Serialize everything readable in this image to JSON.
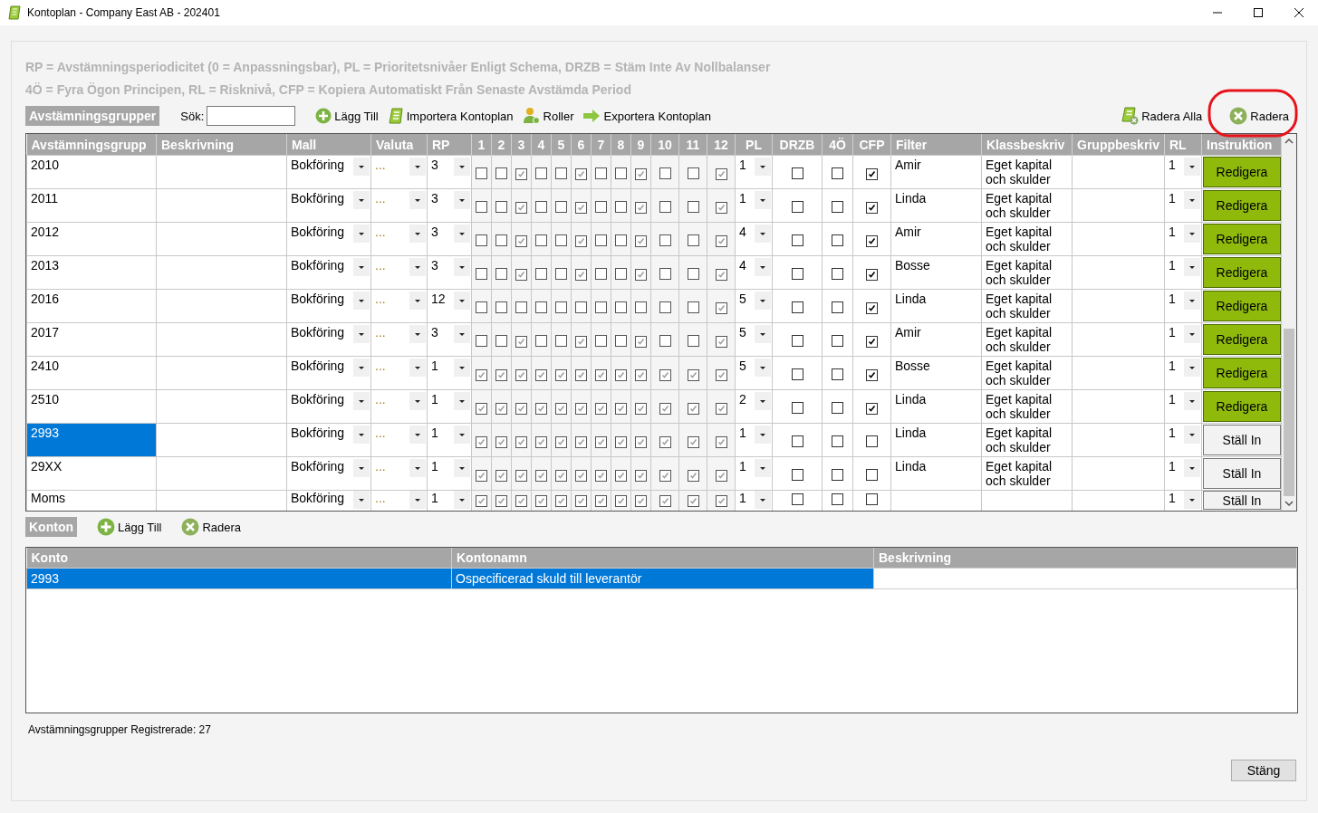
{
  "window": {
    "title": "Kontoplan - Company East AB - 202401"
  },
  "legend": [
    "RP = Avstämningsperiodicitet (0 = Anpassningsbar), PL = Prioritetsnivåer Enligt Schema, DRZB = Stäm Inte Av Nollbalanser",
    "4Ö = Fyra Ögon Principen, RL = Risknivå, CFP = Kopiera Automatiskt Från Senaste Avstämda Period"
  ],
  "toolbar": {
    "section_label": "Avstämningsgrupper",
    "search_label": "Sök:",
    "left_actions": [
      {
        "label": "Lägg Till",
        "kind": "add"
      },
      {
        "label": "Importera Kontoplan",
        "kind": "import"
      },
      {
        "label": "Roller",
        "kind": "roles"
      },
      {
        "label": "Exportera Kontoplan",
        "kind": "export"
      }
    ],
    "right_actions": [
      {
        "label": "Radera Alla",
        "kind": "delete_all",
        "highlighted": false
      },
      {
        "label": "Radera",
        "kind": "delete",
        "highlighted": true
      }
    ]
  },
  "groups_table": {
    "columns": [
      "Avstämningsgrupp",
      "Beskrivning",
      "Mall",
      "Valuta",
      "RP",
      "1",
      "2",
      "3",
      "4",
      "5",
      "6",
      "7",
      "8",
      "9",
      "10",
      "11",
      "12",
      "PL",
      "DRZB",
      "4Ö",
      "CFP",
      "Filter",
      "Klassbeskriv",
      "Gruppbeskriv",
      "RL",
      "Instruktion"
    ],
    "rows": [
      {
        "group": "2010",
        "template": "Bokföring",
        "currency": "...",
        "rp": "3",
        "months": [
          false,
          false,
          true,
          false,
          false,
          true,
          false,
          false,
          true,
          false,
          false,
          true
        ],
        "pl": "1",
        "drzb": false,
        "four_eyes": false,
        "cfp": true,
        "filter": "Amir",
        "class_desc": "Eget kapital och skulder",
        "rl": "1",
        "instruction": {
          "label": "Redigera",
          "kind": "edit"
        },
        "selected": false
      },
      {
        "group": "2011",
        "template": "Bokföring",
        "currency": "...",
        "rp": "3",
        "months": [
          false,
          false,
          true,
          false,
          false,
          true,
          false,
          false,
          true,
          false,
          false,
          true
        ],
        "pl": "1",
        "drzb": false,
        "four_eyes": false,
        "cfp": true,
        "filter": "Linda",
        "class_desc": "Eget kapital och skulder",
        "rl": "1",
        "instruction": {
          "label": "Redigera",
          "kind": "edit"
        },
        "selected": false
      },
      {
        "group": "2012",
        "template": "Bokföring",
        "currency": "...",
        "rp": "3",
        "months": [
          false,
          false,
          true,
          false,
          false,
          true,
          false,
          false,
          true,
          false,
          false,
          true
        ],
        "pl": "4",
        "drzb": false,
        "four_eyes": false,
        "cfp": true,
        "filter": "Amir",
        "class_desc": "Eget kapital och skulder",
        "rl": "1",
        "instruction": {
          "label": "Redigera",
          "kind": "edit"
        },
        "selected": false
      },
      {
        "group": "2013",
        "template": "Bokföring",
        "currency": "...",
        "rp": "3",
        "months": [
          false,
          false,
          true,
          false,
          false,
          true,
          false,
          false,
          true,
          false,
          false,
          true
        ],
        "pl": "4",
        "drzb": false,
        "four_eyes": false,
        "cfp": true,
        "filter": "Bosse",
        "class_desc": "Eget kapital och skulder",
        "rl": "1",
        "instruction": {
          "label": "Redigera",
          "kind": "edit"
        },
        "selected": false
      },
      {
        "group": "2016",
        "template": "Bokföring",
        "currency": "...",
        "rp": "12",
        "months": [
          false,
          false,
          false,
          false,
          false,
          false,
          false,
          false,
          false,
          false,
          false,
          true
        ],
        "pl": "5",
        "drzb": false,
        "four_eyes": false,
        "cfp": true,
        "filter": "Linda",
        "class_desc": "Eget kapital och skulder",
        "rl": "1",
        "instruction": {
          "label": "Redigera",
          "kind": "edit"
        },
        "selected": false
      },
      {
        "group": "2017",
        "template": "Bokföring",
        "currency": "...",
        "rp": "3",
        "months": [
          false,
          false,
          true,
          false,
          false,
          true,
          false,
          false,
          true,
          false,
          false,
          true
        ],
        "pl": "5",
        "drzb": false,
        "four_eyes": false,
        "cfp": true,
        "filter": "Amir",
        "class_desc": "Eget kapital och skulder",
        "rl": "1",
        "instruction": {
          "label": "Redigera",
          "kind": "edit"
        },
        "selected": false
      },
      {
        "group": "2410",
        "template": "Bokföring",
        "currency": "...",
        "rp": "1",
        "months": [
          true,
          true,
          true,
          true,
          true,
          true,
          true,
          true,
          true,
          true,
          true,
          true
        ],
        "pl": "5",
        "drzb": false,
        "four_eyes": false,
        "cfp": true,
        "filter": "Bosse",
        "class_desc": "Eget kapital och skulder",
        "rl": "1",
        "instruction": {
          "label": "Redigera",
          "kind": "edit"
        },
        "selected": false
      },
      {
        "group": "2510",
        "template": "Bokföring",
        "currency": "...",
        "rp": "1",
        "months": [
          true,
          true,
          true,
          true,
          true,
          true,
          true,
          true,
          true,
          true,
          true,
          true
        ],
        "pl": "2",
        "drzb": false,
        "four_eyes": false,
        "cfp": true,
        "filter": "Linda",
        "class_desc": "Eget kapital och skulder",
        "rl": "1",
        "instruction": {
          "label": "Redigera",
          "kind": "edit"
        },
        "selected": false
      },
      {
        "group": "2993",
        "template": "Bokföring",
        "currency": "...",
        "rp": "1",
        "months": [
          true,
          true,
          true,
          true,
          true,
          true,
          true,
          true,
          true,
          true,
          true,
          true
        ],
        "pl": "1",
        "drzb": false,
        "four_eyes": false,
        "cfp": false,
        "filter": "Linda",
        "class_desc": "Eget kapital och skulder",
        "rl": "1",
        "instruction": {
          "label": "Ställ In",
          "kind": "set"
        },
        "selected": true
      },
      {
        "group": "29XX",
        "template": "Bokföring",
        "currency": "...",
        "rp": "1",
        "months": [
          true,
          true,
          true,
          true,
          true,
          true,
          true,
          true,
          true,
          true,
          true,
          true
        ],
        "pl": "1",
        "drzb": false,
        "four_eyes": false,
        "cfp": false,
        "filter": "Linda",
        "class_desc": "Eget kapital och skulder",
        "rl": "1",
        "instruction": {
          "label": "Ställ In",
          "kind": "set"
        },
        "selected": false
      },
      {
        "group": "Moms",
        "template": "Bokföring",
        "currency": "...",
        "rp": "1",
        "months": [
          true,
          true,
          true,
          true,
          true,
          true,
          true,
          true,
          true,
          true,
          true,
          true
        ],
        "pl": "1",
        "drzb": false,
        "four_eyes": false,
        "cfp": false,
        "rl": "1",
        "instruction": {
          "label": "Ställ In",
          "kind": "set"
        },
        "selected": false
      }
    ]
  },
  "accounts_toolbar": {
    "section_label": "Konton",
    "actions": [
      {
        "label": "Lägg Till",
        "kind": "add"
      },
      {
        "label": "Radera",
        "kind": "delete"
      }
    ]
  },
  "accounts_table": {
    "columns": [
      "Konto",
      "Kontonamn",
      "Beskrivning"
    ],
    "rows": [
      {
        "account": "2993",
        "name": "Ospecificerad skuld till leverantör",
        "selected": true
      }
    ]
  },
  "status_bar": {
    "text": "Avstämningsgrupper Registrerade: 27"
  },
  "buttons": {
    "close": "Stäng"
  }
}
